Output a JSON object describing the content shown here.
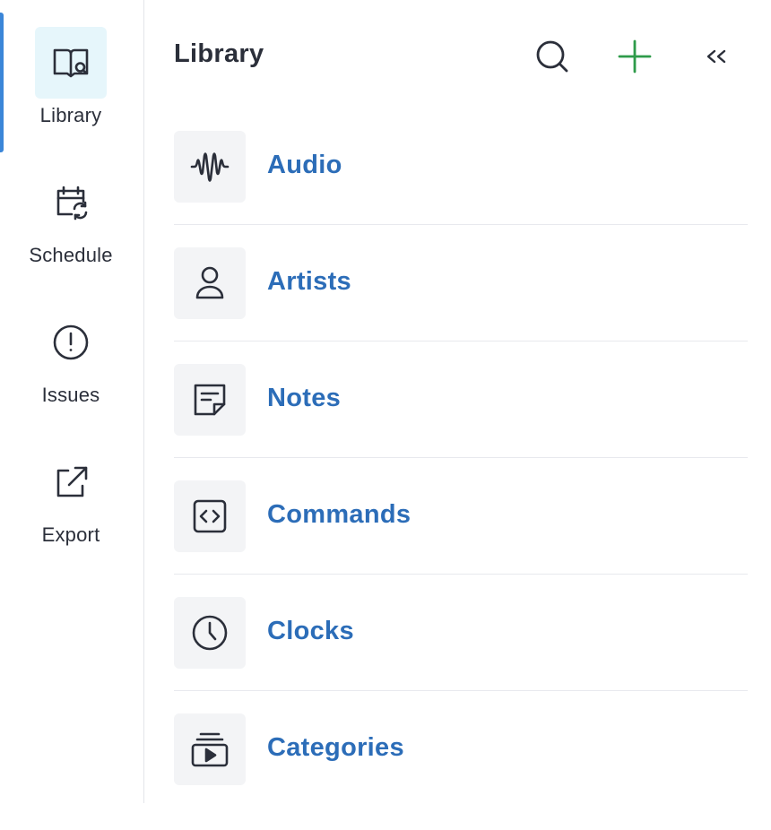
{
  "colors": {
    "accent": "#3b86d8",
    "link": "#2c6db8",
    "add": "#2e9b4a",
    "text": "#2b2f3a",
    "active_bg": "#e6f6fb"
  },
  "rail": {
    "items": [
      {
        "label": "Library",
        "icon": "book-search-icon",
        "active": true
      },
      {
        "label": "Schedule",
        "icon": "calendar-sync-icon",
        "active": false
      },
      {
        "label": "Issues",
        "icon": "alert-circle-icon",
        "active": false
      },
      {
        "label": "Export",
        "icon": "external-link-icon",
        "active": false
      }
    ]
  },
  "panel": {
    "title": "Library",
    "actions": [
      {
        "icon": "search-icon"
      },
      {
        "icon": "plus-icon"
      },
      {
        "icon": "collapse-icon"
      }
    ],
    "items": [
      {
        "label": "Audio",
        "icon": "waveform-icon"
      },
      {
        "label": "Artists",
        "icon": "person-icon"
      },
      {
        "label": "Notes",
        "icon": "note-icon"
      },
      {
        "label": "Commands",
        "icon": "code-icon"
      },
      {
        "label": "Clocks",
        "icon": "clock-icon"
      },
      {
        "label": "Categories",
        "icon": "stack-play-icon"
      }
    ]
  }
}
